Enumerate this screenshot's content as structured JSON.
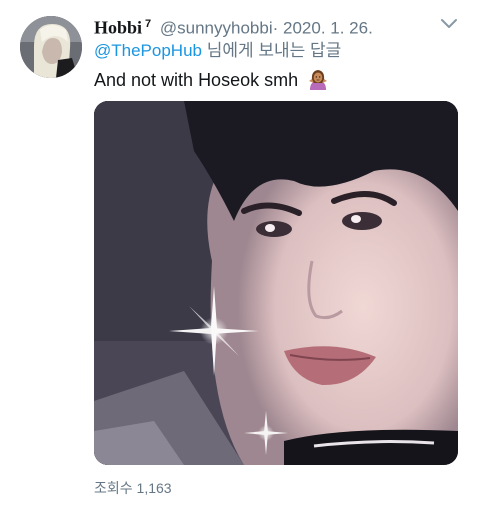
{
  "tweet": {
    "display_name": "Hobbi",
    "badge": "7",
    "handle": "@sunnyyhobbi",
    "separator": "·",
    "date": "2020. 1. 26.",
    "reply_to": {
      "mention": "@ThePopHub",
      "suffix": " 님에게 보내는 답글"
    },
    "text": "And not with Hoseok smh",
    "emoji": "woman-shrugging-icon",
    "views": "조회수 1,163"
  },
  "colors": {
    "accent": "#1b95e0",
    "secondary_text": "#657786",
    "primary_text": "#14171a"
  }
}
